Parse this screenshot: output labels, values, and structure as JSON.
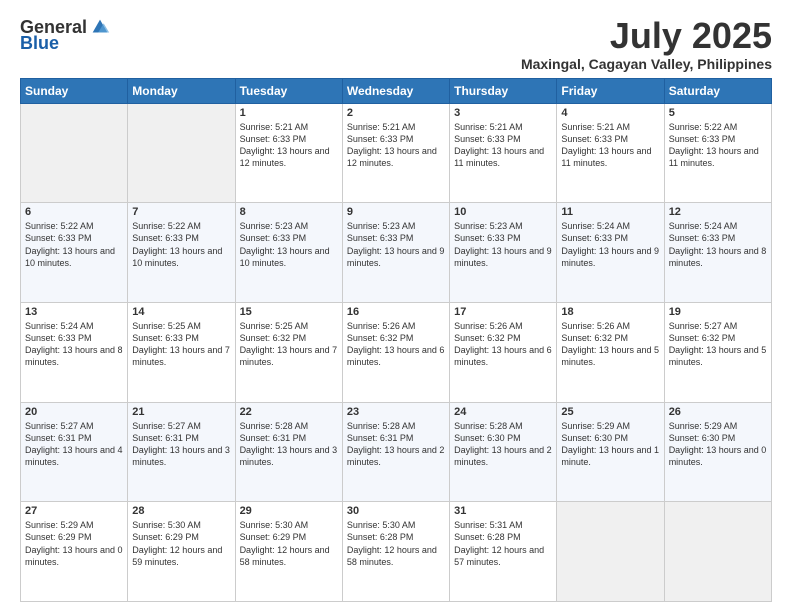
{
  "logo": {
    "general": "General",
    "blue": "Blue"
  },
  "title": "July 2025",
  "location": "Maxingal, Cagayan Valley, Philippines",
  "weekdays": [
    "Sunday",
    "Monday",
    "Tuesday",
    "Wednesday",
    "Thursday",
    "Friday",
    "Saturday"
  ],
  "weeks": [
    [
      {
        "day": "",
        "info": ""
      },
      {
        "day": "",
        "info": ""
      },
      {
        "day": "1",
        "info": "Sunrise: 5:21 AM\nSunset: 6:33 PM\nDaylight: 13 hours and 12 minutes."
      },
      {
        "day": "2",
        "info": "Sunrise: 5:21 AM\nSunset: 6:33 PM\nDaylight: 13 hours and 12 minutes."
      },
      {
        "day": "3",
        "info": "Sunrise: 5:21 AM\nSunset: 6:33 PM\nDaylight: 13 hours and 11 minutes."
      },
      {
        "day": "4",
        "info": "Sunrise: 5:21 AM\nSunset: 6:33 PM\nDaylight: 13 hours and 11 minutes."
      },
      {
        "day": "5",
        "info": "Sunrise: 5:22 AM\nSunset: 6:33 PM\nDaylight: 13 hours and 11 minutes."
      }
    ],
    [
      {
        "day": "6",
        "info": "Sunrise: 5:22 AM\nSunset: 6:33 PM\nDaylight: 13 hours and 10 minutes."
      },
      {
        "day": "7",
        "info": "Sunrise: 5:22 AM\nSunset: 6:33 PM\nDaylight: 13 hours and 10 minutes."
      },
      {
        "day": "8",
        "info": "Sunrise: 5:23 AM\nSunset: 6:33 PM\nDaylight: 13 hours and 10 minutes."
      },
      {
        "day": "9",
        "info": "Sunrise: 5:23 AM\nSunset: 6:33 PM\nDaylight: 13 hours and 9 minutes."
      },
      {
        "day": "10",
        "info": "Sunrise: 5:23 AM\nSunset: 6:33 PM\nDaylight: 13 hours and 9 minutes."
      },
      {
        "day": "11",
        "info": "Sunrise: 5:24 AM\nSunset: 6:33 PM\nDaylight: 13 hours and 9 minutes."
      },
      {
        "day": "12",
        "info": "Sunrise: 5:24 AM\nSunset: 6:33 PM\nDaylight: 13 hours and 8 minutes."
      }
    ],
    [
      {
        "day": "13",
        "info": "Sunrise: 5:24 AM\nSunset: 6:33 PM\nDaylight: 13 hours and 8 minutes."
      },
      {
        "day": "14",
        "info": "Sunrise: 5:25 AM\nSunset: 6:33 PM\nDaylight: 13 hours and 7 minutes."
      },
      {
        "day": "15",
        "info": "Sunrise: 5:25 AM\nSunset: 6:32 PM\nDaylight: 13 hours and 7 minutes."
      },
      {
        "day": "16",
        "info": "Sunrise: 5:26 AM\nSunset: 6:32 PM\nDaylight: 13 hours and 6 minutes."
      },
      {
        "day": "17",
        "info": "Sunrise: 5:26 AM\nSunset: 6:32 PM\nDaylight: 13 hours and 6 minutes."
      },
      {
        "day": "18",
        "info": "Sunrise: 5:26 AM\nSunset: 6:32 PM\nDaylight: 13 hours and 5 minutes."
      },
      {
        "day": "19",
        "info": "Sunrise: 5:27 AM\nSunset: 6:32 PM\nDaylight: 13 hours and 5 minutes."
      }
    ],
    [
      {
        "day": "20",
        "info": "Sunrise: 5:27 AM\nSunset: 6:31 PM\nDaylight: 13 hours and 4 minutes."
      },
      {
        "day": "21",
        "info": "Sunrise: 5:27 AM\nSunset: 6:31 PM\nDaylight: 13 hours and 3 minutes."
      },
      {
        "day": "22",
        "info": "Sunrise: 5:28 AM\nSunset: 6:31 PM\nDaylight: 13 hours and 3 minutes."
      },
      {
        "day": "23",
        "info": "Sunrise: 5:28 AM\nSunset: 6:31 PM\nDaylight: 13 hours and 2 minutes."
      },
      {
        "day": "24",
        "info": "Sunrise: 5:28 AM\nSunset: 6:30 PM\nDaylight: 13 hours and 2 minutes."
      },
      {
        "day": "25",
        "info": "Sunrise: 5:29 AM\nSunset: 6:30 PM\nDaylight: 13 hours and 1 minute."
      },
      {
        "day": "26",
        "info": "Sunrise: 5:29 AM\nSunset: 6:30 PM\nDaylight: 13 hours and 0 minutes."
      }
    ],
    [
      {
        "day": "27",
        "info": "Sunrise: 5:29 AM\nSunset: 6:29 PM\nDaylight: 13 hours and 0 minutes."
      },
      {
        "day": "28",
        "info": "Sunrise: 5:30 AM\nSunset: 6:29 PM\nDaylight: 12 hours and 59 minutes."
      },
      {
        "day": "29",
        "info": "Sunrise: 5:30 AM\nSunset: 6:29 PM\nDaylight: 12 hours and 58 minutes."
      },
      {
        "day": "30",
        "info": "Sunrise: 5:30 AM\nSunset: 6:28 PM\nDaylight: 12 hours and 58 minutes."
      },
      {
        "day": "31",
        "info": "Sunrise: 5:31 AM\nSunset: 6:28 PM\nDaylight: 12 hours and 57 minutes."
      },
      {
        "day": "",
        "info": ""
      },
      {
        "day": "",
        "info": ""
      }
    ]
  ]
}
